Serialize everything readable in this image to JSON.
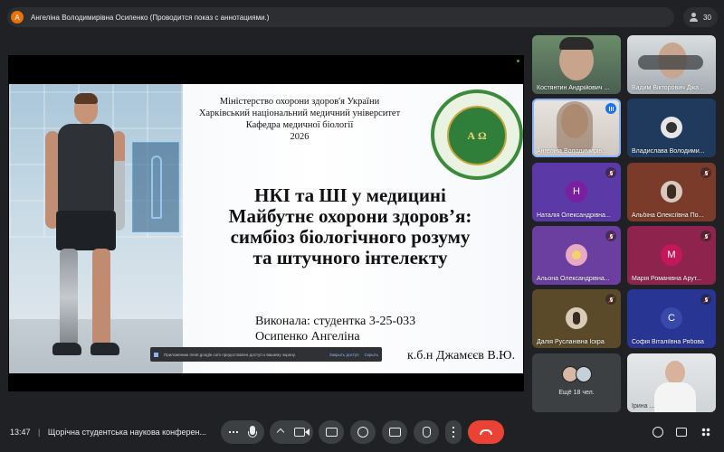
{
  "banner": {
    "avatar_letter": "А",
    "text": "Ангеліна Володимирівна Осипенко (Проводится показ с аннотациями.)",
    "participant_count": "30"
  },
  "slide": {
    "header_lines": [
      "Міністерство охорони здоров'я  України",
      "Харківський національний медичний університет",
      "Кафедра медичної біології",
      "2026"
    ],
    "title_lines": [
      "НКІ та ШІ у медицині",
      "Майбутнє охорони здоров’я:",
      "симбіоз біологічного розуму",
      "та штучного інтелекту"
    ],
    "author_line1": "Виконала: студентка 3-25-033",
    "author_line2": "Осипенко Ангеліна",
    "supervisor_fragment": "к.б.н Джамєєв В.Ю."
  },
  "share_toast": {
    "text": "Приложению meet.google.com предоставлен доступ к вашему экрану.",
    "stop_label": "Закрыть доступ",
    "hide_label": "Скрыть"
  },
  "tiles": [
    {
      "name": "Костянтин Андрійович ...",
      "type": "video",
      "state": "none"
    },
    {
      "name": "Вадим Вікторович Джам...",
      "type": "video",
      "state": "none"
    },
    {
      "name": "Ангеліна Володимирівна...",
      "type": "video",
      "state": "speaking"
    },
    {
      "name": "Владислава Володими...",
      "type": "image",
      "state": "none"
    },
    {
      "name": "Наталія Олександрівна...",
      "type": "letter",
      "letter": "Н",
      "color": "#7b1fa2",
      "bg": "#5e35b1",
      "state": "muted"
    },
    {
      "name": "Альбіна Олексіївна По...",
      "type": "image",
      "state": "muted"
    },
    {
      "name": "Альона Олександрівна...",
      "type": "image",
      "state": "muted"
    },
    {
      "name": "Марія Романівна Арут...",
      "type": "letter",
      "letter": "М",
      "color": "#c2185b",
      "bg": "#8e244d",
      "state": "muted"
    },
    {
      "name": "Далія Русланівна Іскра",
      "type": "image",
      "state": "muted"
    },
    {
      "name": "Софія Віталіївна Рябова",
      "type": "letter",
      "letter": "С",
      "color": "#3949ab",
      "bg": "#283593",
      "state": "muted"
    },
    {
      "name": "Ещё 18 чел.",
      "type": "more",
      "state": "none"
    },
    {
      "name": "Ірина ...",
      "type": "video",
      "state": "none"
    }
  ],
  "footer": {
    "time": "13:47",
    "separator": "|",
    "meeting_title": "Щорічна студентська наукова конферен..."
  },
  "colors": {
    "background": "#202124",
    "surface": "#3c4043",
    "end_call": "#ea4335",
    "accent": "#8ab4f8"
  },
  "icons": [
    "more-options-icon",
    "microphone-icon",
    "chevron-up-icon",
    "camera-icon",
    "present-screen-icon",
    "emoji-icon",
    "captions-icon",
    "raise-hand-icon",
    "more-vert-icon",
    "end-call-icon",
    "info-icon",
    "chat-icon",
    "people-icon",
    "activities-icon"
  ]
}
